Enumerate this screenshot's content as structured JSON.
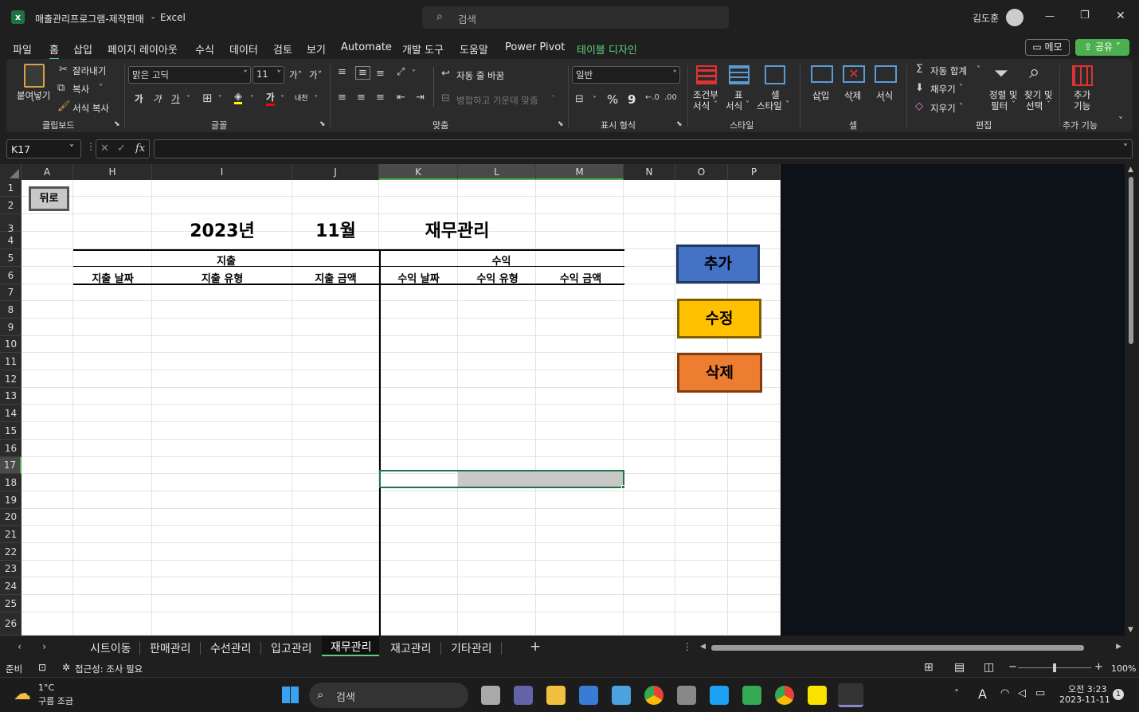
{
  "titlebar": {
    "filename": "매출관리프로그램-제작판매",
    "sep": "-",
    "app": "Excel",
    "search_placeholder": "검색",
    "user": "김도훈",
    "min": "—",
    "restore": "❐",
    "close": "✕"
  },
  "menu": [
    "파일",
    "홈",
    "삽입",
    "페이지 레이아웃",
    "수식",
    "데이터",
    "검토",
    "보기",
    "Automate",
    "개발 도구",
    "도움말",
    "Power Pivot",
    "테이블 디자인"
  ],
  "menu_right": {
    "memo": "메모",
    "share": "공유"
  },
  "ribbon": {
    "clipboard": {
      "paste": "붙여넣기",
      "cut": "잘라내기",
      "copy": "복사",
      "format_painter": "서식 복사",
      "label": "클립보드"
    },
    "font": {
      "name": "맑은 고딕",
      "size": "11",
      "grow": "가˄",
      "shrink": "가˅",
      "bold": "가",
      "italic": "가",
      "underline": "가",
      "phonetic": "내천",
      "label": "글꼴"
    },
    "align": {
      "wrap": "자동 줄 바꿈",
      "merge": "병합하고 가운데 맞춤",
      "label": "맞춤"
    },
    "number": {
      "format": "일반",
      "percent": "%",
      "comma": "9",
      "label": "표시 형식"
    },
    "styles": {
      "cond1": "조건부",
      "cond2": "서식",
      "table1": "표",
      "table2": "서식",
      "cell1": "셀",
      "cell2": "스타일",
      "label": "스타일"
    },
    "cells": {
      "insert": "삽입",
      "delete": "삭제",
      "format": "서식",
      "label": "셀"
    },
    "editing": {
      "autosum": "자동 합계",
      "fill": "채우기",
      "clear": "지우기",
      "sort1": "정렬 및",
      "sort2": "필터",
      "find1": "찾기 및",
      "find2": "선택",
      "label": "편집"
    },
    "addins": {
      "l1": "추가",
      "l2": "기능",
      "label": "추가 기능"
    }
  },
  "formula_bar": {
    "name_box": "K17",
    "fx": "fx",
    "value": ""
  },
  "columns": [
    {
      "label": "A",
      "sel": false
    },
    {
      "label": "H",
      "sel": false
    },
    {
      "label": "I",
      "sel": false
    },
    {
      "label": "J",
      "sel": false
    },
    {
      "label": "K",
      "sel": true
    },
    {
      "label": "L",
      "sel": true
    },
    {
      "label": "M",
      "sel": true
    },
    {
      "label": "N",
      "sel": false
    },
    {
      "label": "O",
      "sel": false
    },
    {
      "label": "P",
      "sel": false
    }
  ],
  "rows": [
    "1",
    "2",
    "3",
    "4",
    "5",
    "6",
    "7",
    "8",
    "9",
    "10",
    "11",
    "12",
    "13",
    "14",
    "15",
    "16",
    "17",
    "18",
    "19",
    "20",
    "21",
    "22",
    "23",
    "24",
    "25",
    "26"
  ],
  "selected_row": "17",
  "sheet": {
    "back_button": "뒤로",
    "year": "2023년",
    "month": "11월",
    "title": "재무관리",
    "expense": "지출",
    "income": "수익",
    "headers": [
      "지출 날짜",
      "지출 유형",
      "지출 금액",
      "수익 날짜",
      "수익 유형",
      "수익 금액"
    ],
    "buttons": {
      "add": {
        "label": "추가",
        "color": "#4472c4",
        "border": "#1f3864"
      },
      "edit": {
        "label": "수정",
        "color": "#ffc000",
        "border": "#7f6000"
      },
      "delete": {
        "label": "삭제",
        "color": "#ed7d31",
        "border": "#843c0c"
      }
    }
  },
  "tabs": [
    "시트이동",
    "판매관리",
    "수선관리",
    "입고관리",
    "재무관리",
    "재고관리",
    "기타관리"
  ],
  "active_tab": "재무관리",
  "status": {
    "ready": "준비",
    "accessibility": "접근성: 조사 필요",
    "zoom": "100%"
  },
  "taskbar": {
    "temp": "1°C",
    "weather": "구름 조금",
    "search": "검색",
    "time": "오전 3:23",
    "date": "2023-11-11",
    "badge": "1",
    "lang": "A"
  }
}
